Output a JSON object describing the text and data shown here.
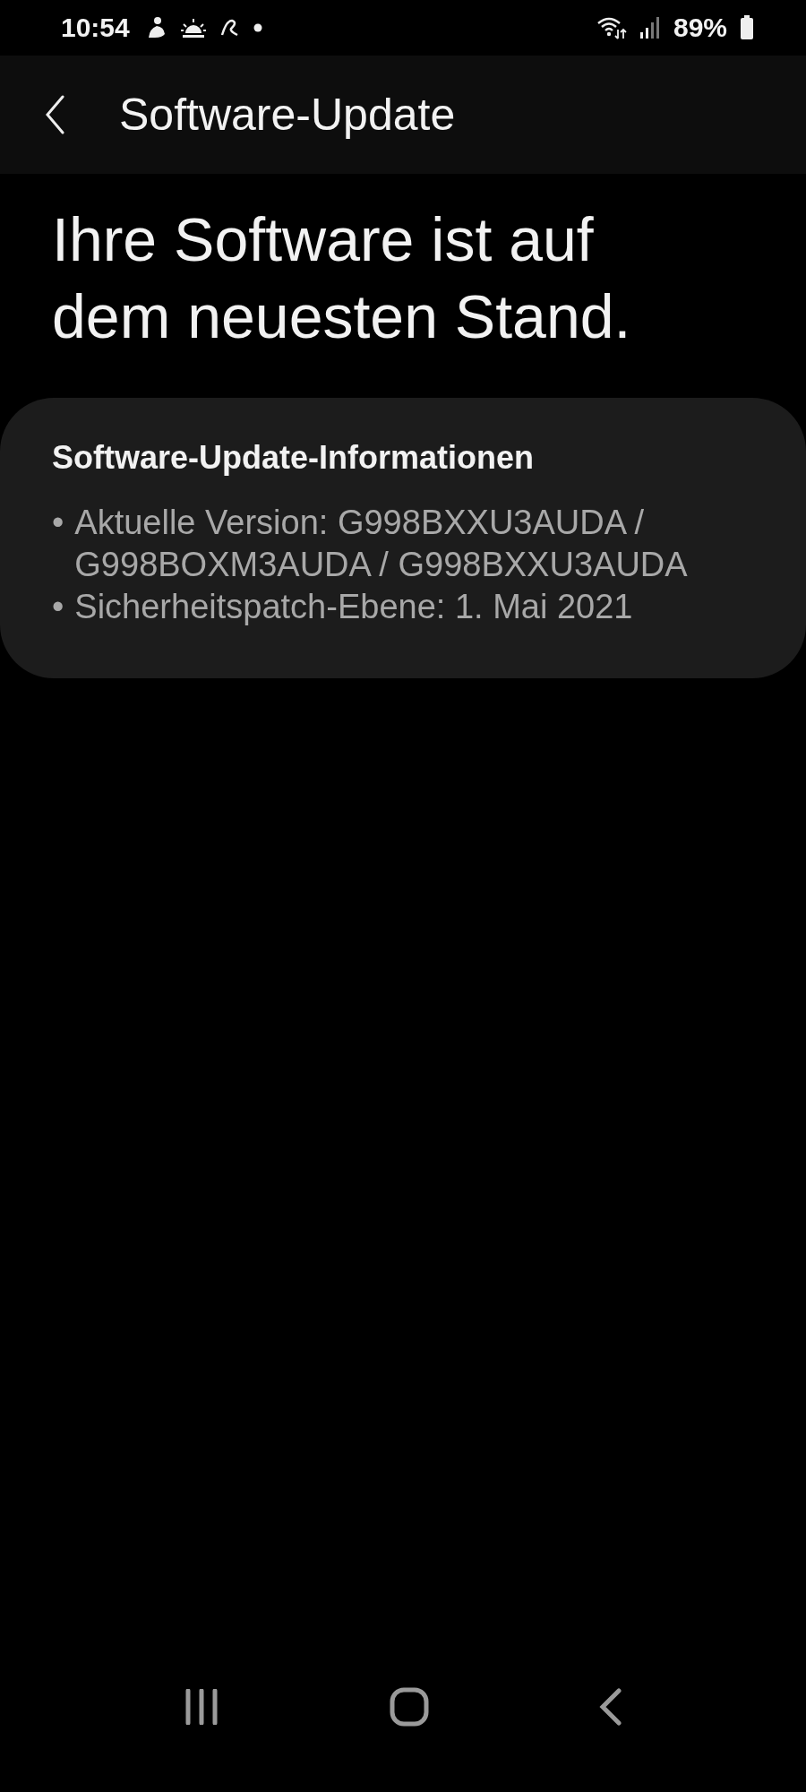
{
  "status_bar": {
    "time": "10:54",
    "battery": "89%"
  },
  "app_bar": {
    "title": "Software-Update"
  },
  "headline": "Ihre Software ist auf dem neuesten Stand.",
  "info_card": {
    "title": "Software-Update-Informationen",
    "items": [
      {
        "bullet": "•",
        "text": "Aktuelle Version: G998BXXU3AUDA / G998BOXM3AUDA / G998BXXU3AUDA"
      },
      {
        "bullet": "•",
        "text": "Sicherheitspatch-Ebene: 1. Mai 2021"
      }
    ]
  }
}
